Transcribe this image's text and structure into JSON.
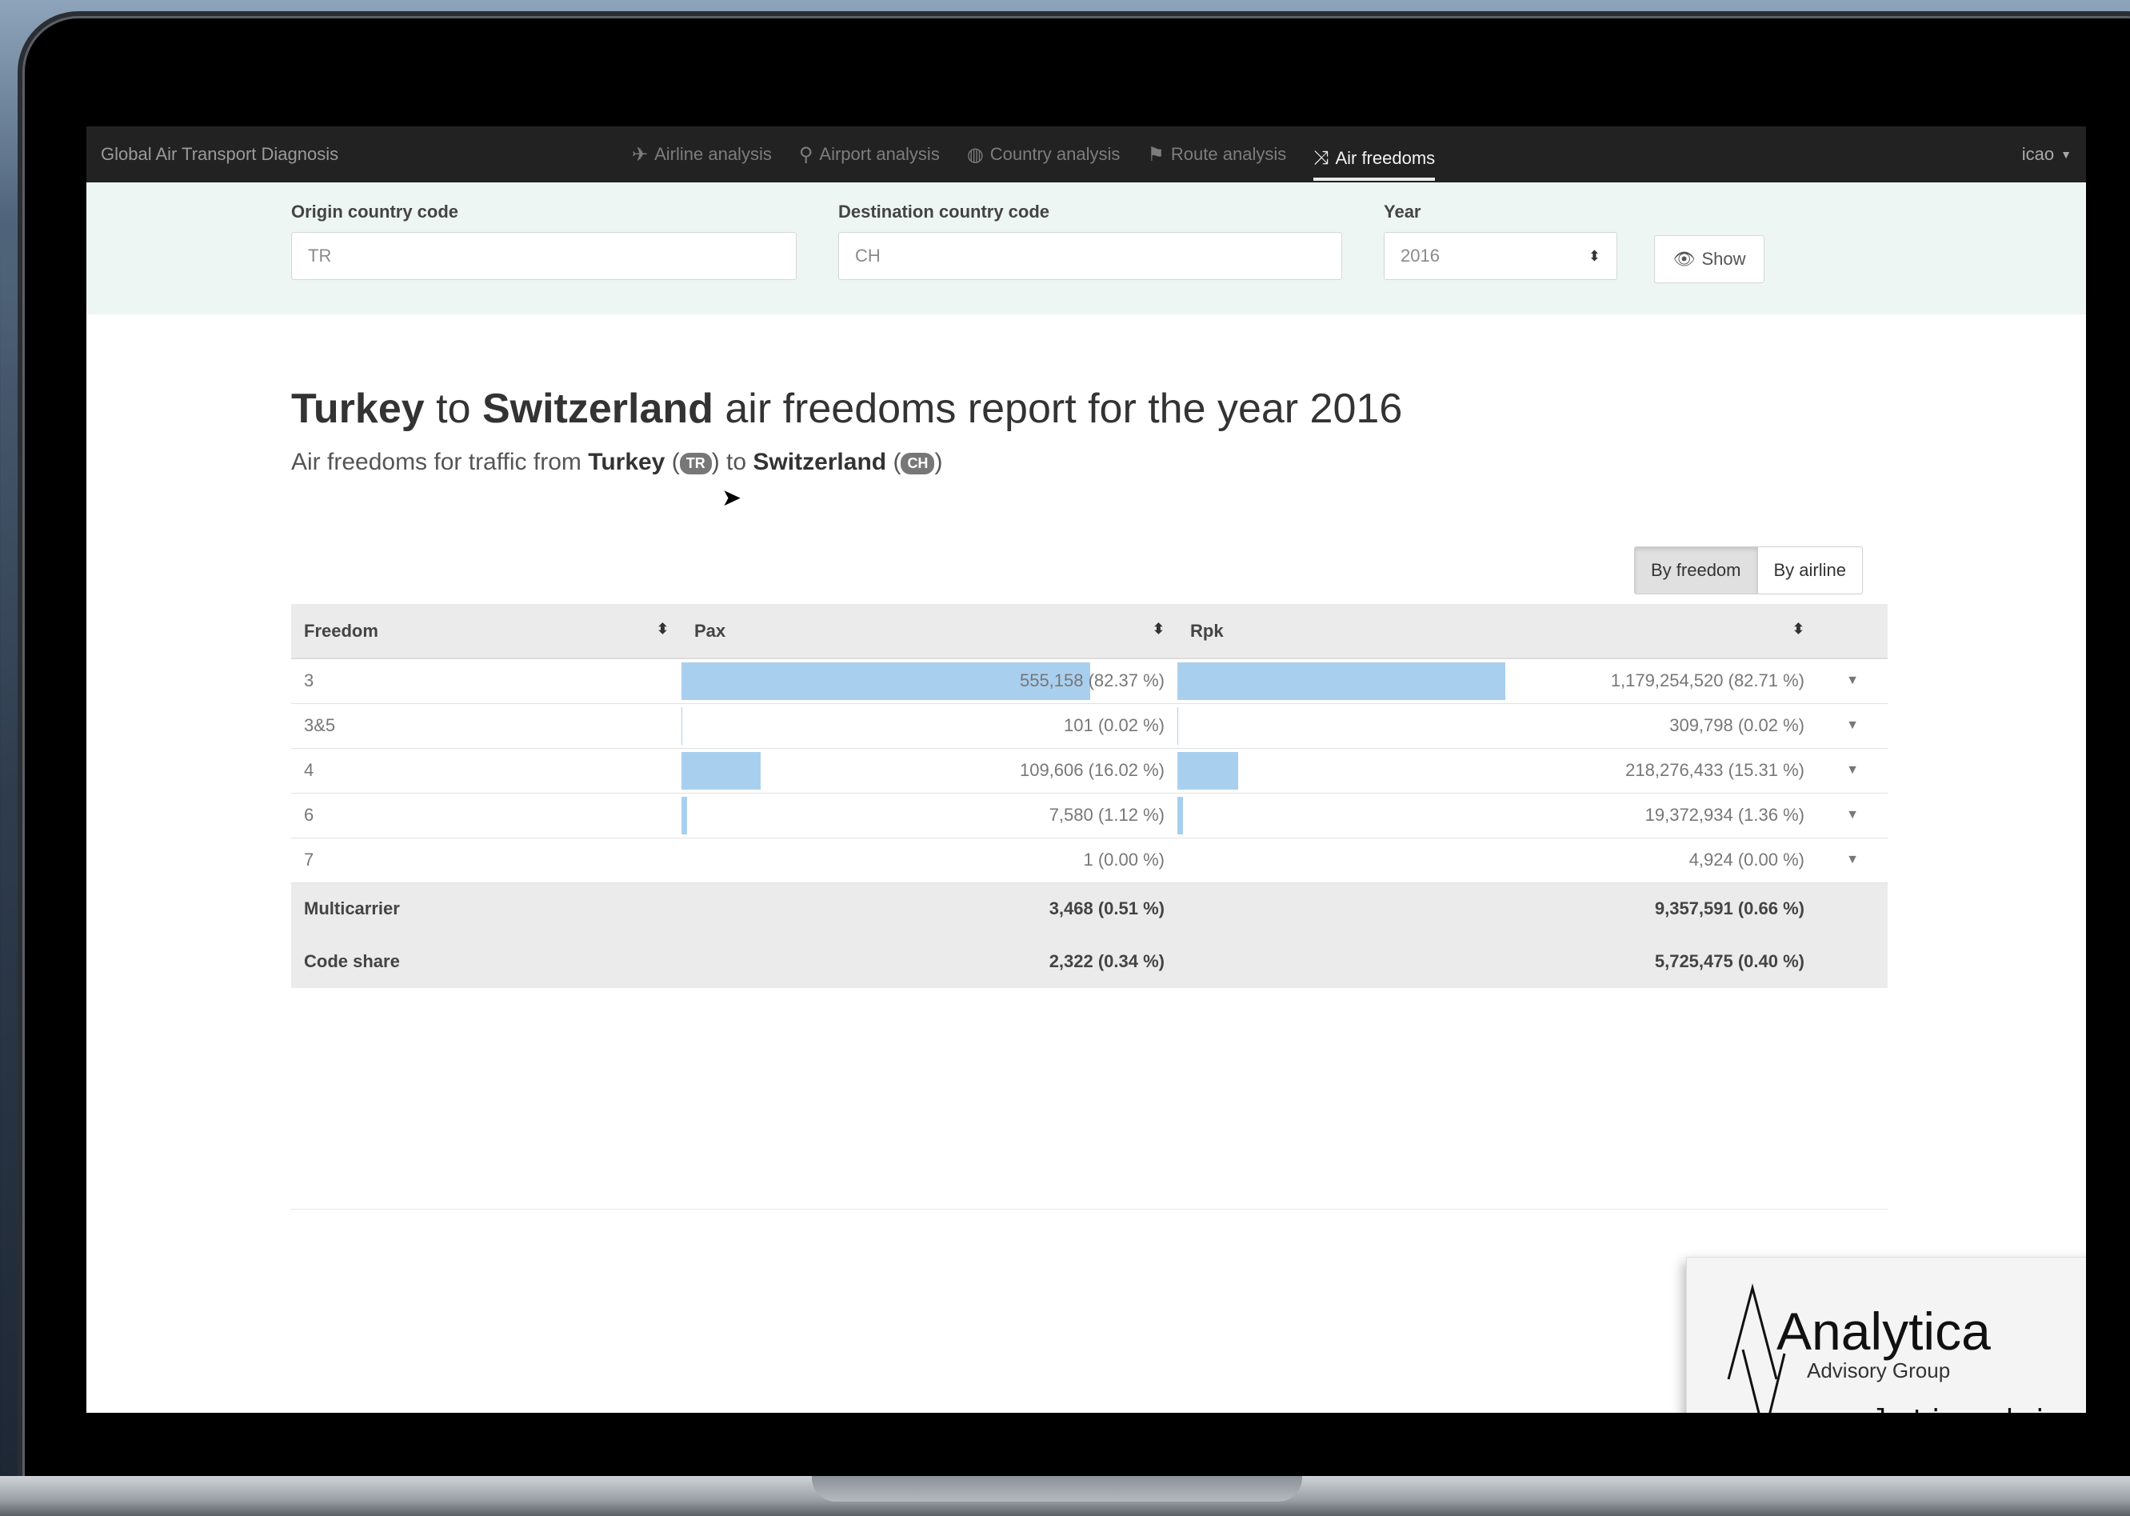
{
  "navbar": {
    "brand": "Global Air Transport Diagnosis",
    "items": [
      {
        "label": "Airline analysis",
        "icon": "airplane-icon"
      },
      {
        "label": "Airport analysis",
        "icon": "user-pin-icon"
      },
      {
        "label": "Country analysis",
        "icon": "globe-icon"
      },
      {
        "label": "Route analysis",
        "icon": "signpost-icon"
      },
      {
        "label": "Air freedoms",
        "icon": "shuffle-icon"
      }
    ],
    "user": "icao"
  },
  "filters": {
    "origin_label": "Origin country code",
    "origin_value": "TR",
    "destination_label": "Destination country code",
    "destination_value": "CH",
    "year_label": "Year",
    "year_value": "2016",
    "show_label": "Show"
  },
  "report": {
    "origin_name": "Turkey",
    "destination_name": "Switzerland",
    "connector": "to",
    "title_rest": "air freedoms report for the year 2016",
    "subtitle_prefix": "Air freedoms for traffic from",
    "origin_code": "TR",
    "destination_code": "CH"
  },
  "view_toggle": {
    "by_freedom": "By freedom",
    "by_airline": "By airline"
  },
  "table": {
    "headers": [
      "Freedom",
      "Pax",
      "Rpk"
    ],
    "rows": [
      {
        "freedom": "3",
        "pax": "555,158 (82.37 %)",
        "pax_pct": 82.37,
        "rpk": "1,179,254,520 (82.71 %)",
        "rpk_pct": 82.71
      },
      {
        "freedom": "3&5",
        "pax": "101 (0.02 %)",
        "pax_pct": 0.02,
        "rpk": "309,798 (0.02 %)",
        "rpk_pct": 0.02
      },
      {
        "freedom": "4",
        "pax": "109,606 (16.02 %)",
        "pax_pct": 16.02,
        "rpk": "218,276,433 (15.31 %)",
        "rpk_pct": 15.31
      },
      {
        "freedom": "6",
        "pax": "7,580 (1.12 %)",
        "pax_pct": 1.12,
        "rpk": "19,372,934 (1.36 %)",
        "rpk_pct": 1.36
      },
      {
        "freedom": "7",
        "pax": "1 (0.00 %)",
        "pax_pct": 0.0,
        "rpk": "4,924 (0.00 %)",
        "rpk_pct": 0.0
      }
    ],
    "footer": [
      {
        "label": "Multicarrier",
        "pax": "3,468 (0.51 %)",
        "rpk": "9,357,591 (0.66 %)"
      },
      {
        "label": "Code share",
        "pax": "2,322 (0.34 %)",
        "rpk": "5,725,475 (0.40 %)"
      }
    ]
  },
  "watermark": {
    "brand": "Analytica",
    "sub": "Advisory Group",
    "url": "analyticaadvisory.com"
  },
  "colors": {
    "bar": "#a9cfef",
    "navbar": "#222222",
    "filter_bg": "#eef6f3"
  }
}
